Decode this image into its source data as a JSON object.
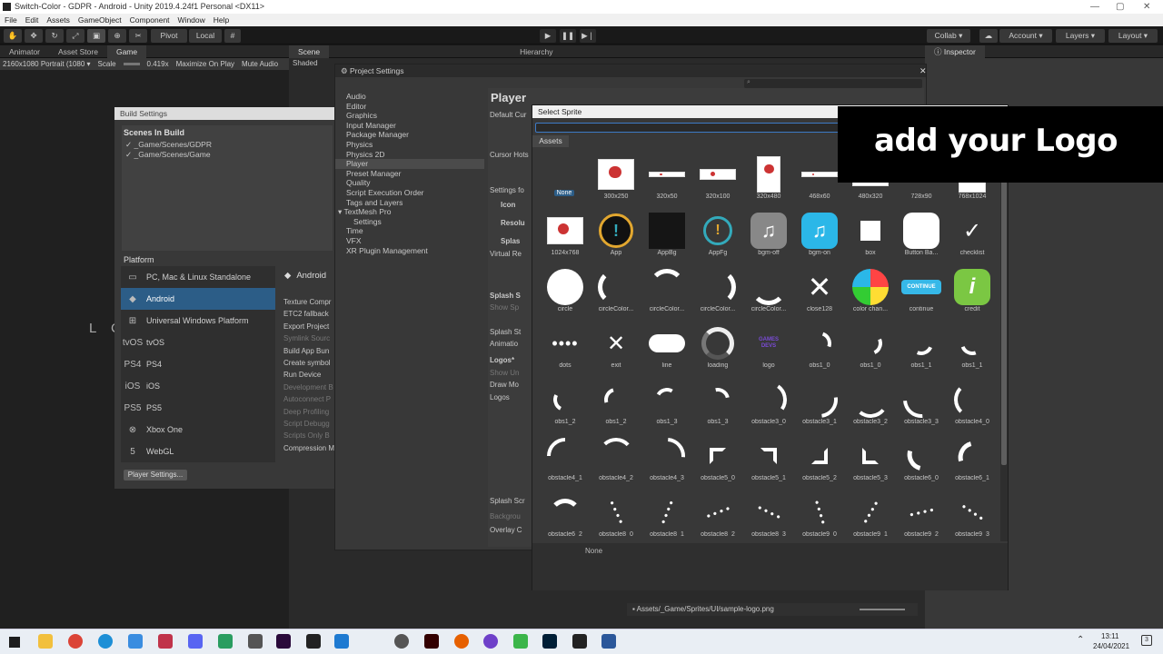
{
  "titlebar": {
    "title": "Switch-Color - GDPR - Android - Unity 2019.4.24f1 Personal <DX11>"
  },
  "menu": [
    "File",
    "Edit",
    "Assets",
    "GameObject",
    "Component",
    "Window",
    "Help"
  ],
  "toolbar": {
    "pivot": "Pivot",
    "local": "Local",
    "collab": "Collab ▾",
    "account": "Account",
    "layers": "Layers",
    "layout": "Layout"
  },
  "game_tabs": {
    "animator": "Animator",
    "asset_store": "Asset Store",
    "game": "Game",
    "resolution": "2160x1080 Portrait (1080 ▾",
    "scale_label": "Scale",
    "scale_value": "0.419x",
    "maximize": "Maximize On Play",
    "mute": "Mute Audio"
  },
  "scene_tabs": {
    "scene": "Scene",
    "shaded": "Shaded",
    "hierarchy": "Hierarchy",
    "inspector": "Inspector"
  },
  "build_settings": {
    "title": "Build Settings",
    "scenes_header": "Scenes In Build",
    "scenes": [
      "✓ _Game/Scenes/GDPR",
      "✓ _Game/Scenes/Game"
    ],
    "platform_header": "Platform",
    "platforms": [
      {
        "label": "PC, Mac & Linux Standalone",
        "icon": "monitor-icon",
        "glyph": "▭"
      },
      {
        "label": "Android",
        "icon": "android-icon",
        "glyph": "◆"
      },
      {
        "label": "Universal Windows Platform",
        "icon": "windows-icon",
        "glyph": "⊞"
      },
      {
        "label": "tvOS",
        "icon": "tvos-icon",
        "glyph": "tvOS"
      },
      {
        "label": "PS4",
        "icon": "ps4-icon",
        "glyph": "PS4"
      },
      {
        "label": "iOS",
        "icon": "ios-icon",
        "glyph": "iOS"
      },
      {
        "label": "PS5",
        "icon": "ps5-icon",
        "glyph": "PS5"
      },
      {
        "label": "Xbox One",
        "icon": "xbox-icon",
        "glyph": "⊗"
      },
      {
        "label": "WebGL",
        "icon": "html5-icon",
        "glyph": "5"
      }
    ],
    "right_header": "Android",
    "options": [
      "Texture Compr",
      "ETC2 fallback",
      "Export Project",
      "Symlink Sourc",
      "Build App Bun",
      "Create symbol",
      "Run Device",
      "Development B",
      "Autoconnect P",
      "Deep Profiling",
      "Script Debugg",
      "Scripts Only B",
      "Compression M"
    ],
    "player_settings_btn": "Player Settings..."
  },
  "project_settings": {
    "title": "Project Settings",
    "items": [
      "Audio",
      "Editor",
      "Graphics",
      "Input Manager",
      "Package Manager",
      "Physics",
      "Physics 2D",
      "Player",
      "Preset Manager",
      "Quality",
      "Script Execution Order",
      "Tags and Layers",
      "TextMesh Pro",
      "Settings",
      "Time",
      "VFX",
      "XR Plugin Management"
    ],
    "selected": "Player",
    "heading": "Player",
    "fields": [
      "Default Cur",
      "Cursor Hots",
      "Settings fo",
      "Icon",
      "Resolu",
      "Splas",
      "Virtual Re",
      "Splash S",
      "Show Sp",
      "Splash St",
      "Animatio",
      "Logos*",
      "Show Un",
      "Draw Mo",
      "Logos",
      "Splash Scr",
      "Backgrou",
      "Overlay C"
    ]
  },
  "select_sprite": {
    "title": "Select Sprite",
    "search_value": "",
    "tab": "Assets",
    "footer": "None",
    "sprites": [
      {
        "name": "None"
      },
      {
        "name": "300x250"
      },
      {
        "name": "320x50"
      },
      {
        "name": "320x100"
      },
      {
        "name": "320x480"
      },
      {
        "name": "468x60"
      },
      {
        "name": "480x320"
      },
      {
        "name": "728x90"
      },
      {
        "name": "768x1024"
      },
      {
        "name": "1024x768"
      },
      {
        "name": "App"
      },
      {
        "name": "AppBg"
      },
      {
        "name": "AppFg"
      },
      {
        "name": "bgm-off"
      },
      {
        "name": "bgm-on"
      },
      {
        "name": "box"
      },
      {
        "name": "Button Ba..."
      },
      {
        "name": "checklist"
      },
      {
        "name": "circle"
      },
      {
        "name": "circleColor..."
      },
      {
        "name": "circleColor..."
      },
      {
        "name": "circleColor..."
      },
      {
        "name": "circleColor..."
      },
      {
        "name": "close128"
      },
      {
        "name": "color chan..."
      },
      {
        "name": "continue"
      },
      {
        "name": "credit"
      },
      {
        "name": "dots"
      },
      {
        "name": "exit"
      },
      {
        "name": "line"
      },
      {
        "name": "loading"
      },
      {
        "name": "logo"
      },
      {
        "name": "obs1_0"
      },
      {
        "name": "obs1_0"
      },
      {
        "name": "obs1_1"
      },
      {
        "name": "obs1_1"
      },
      {
        "name": "obs1_2"
      },
      {
        "name": "obs1_2"
      },
      {
        "name": "obs1_3"
      },
      {
        "name": "obs1_3"
      },
      {
        "name": "obstacle3_0"
      },
      {
        "name": "obstacle3_1"
      },
      {
        "name": "obstacle3_2"
      },
      {
        "name": "obstacle3_3"
      },
      {
        "name": "obstacle4_0"
      },
      {
        "name": "obstacle4_1"
      },
      {
        "name": "obstacle4_2"
      },
      {
        "name": "obstacle4_3"
      },
      {
        "name": "obstacle5_0"
      },
      {
        "name": "obstacle5_1"
      },
      {
        "name": "obstacle5_2"
      },
      {
        "name": "obstacle5_3"
      },
      {
        "name": "obstacle6_0"
      },
      {
        "name": "obstacle6_1"
      },
      {
        "name": "obstacle6_2"
      },
      {
        "name": "obstacle8_0"
      },
      {
        "name": "obstacle8_1"
      },
      {
        "name": "obstacle8_2"
      },
      {
        "name": "obstacle8_3"
      },
      {
        "name": "obstacle9_0"
      },
      {
        "name": "obstacle9_1"
      },
      {
        "name": "obstacle9_2"
      },
      {
        "name": "obstacle9_3"
      }
    ]
  },
  "project_panel": {
    "path": "Assets/_Game/Sprites/UI/sample-logo.png"
  },
  "overlay": {
    "text": "add your Logo"
  },
  "game_view_text": "L C",
  "taskbar": {
    "time": "13:11",
    "date": "24/04/2021"
  },
  "colors": {
    "selection": "#2c5d87",
    "panel": "#383838",
    "overlay": "#000000"
  }
}
